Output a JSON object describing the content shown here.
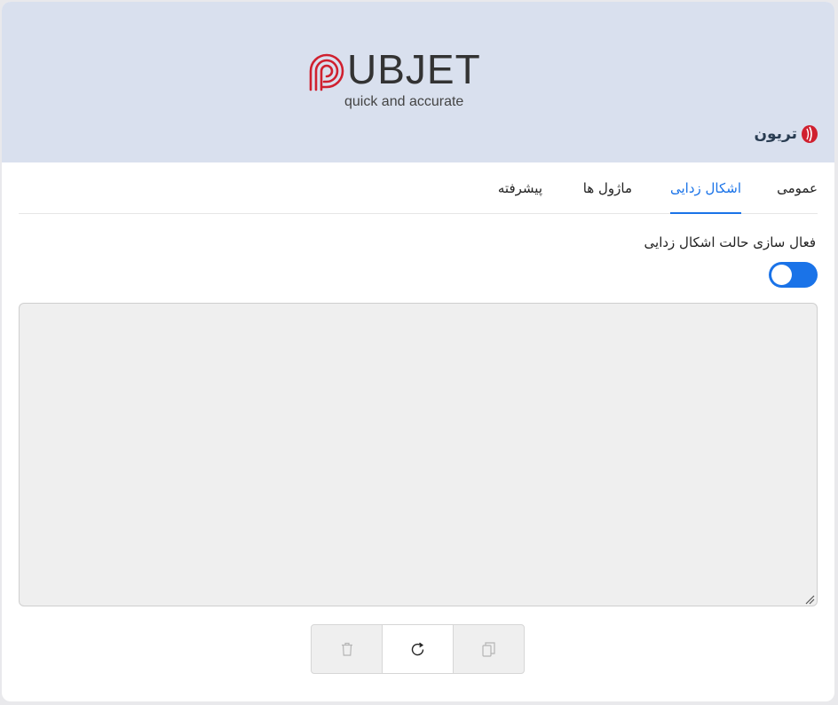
{
  "header": {
    "logo_text": "UBJET",
    "logo_tagline": "quick and accurate",
    "brand_name": "تریون",
    "background_color": "#d9e0ee",
    "logo_accent_color": "#d0202f"
  },
  "tabs": [
    {
      "label": "عمومی",
      "active": false
    },
    {
      "label": "اشکال زدایی",
      "active": true
    },
    {
      "label": "ماژول ها",
      "active": false
    },
    {
      "label": "پیشرفته",
      "active": false
    }
  ],
  "debug": {
    "toggle_label": "فعال سازی حالت اشکال زدایی",
    "toggle_on": true,
    "log_value": "",
    "accent_color": "#1a73e8"
  },
  "actions": {
    "delete_icon": "trash-icon",
    "refresh_icon": "refresh-icon",
    "copy_icon": "copy-icon"
  }
}
